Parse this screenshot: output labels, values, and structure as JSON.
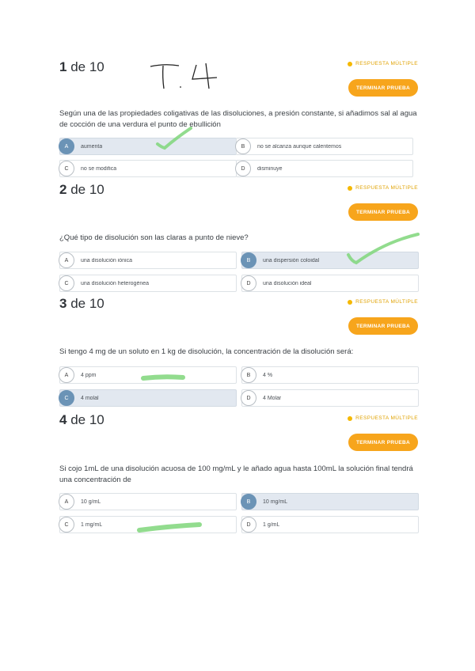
{
  "handwriting": "T 4",
  "badge_label": "RESPUESTA MÚLTIPLE",
  "end_button_label": "TERMINAR PRUEBA",
  "questions": [
    {
      "number": "1",
      "of_label": "de 10",
      "text": "Según una de las propiedades coligativas de las disoluciones, a presión constante, si añadimos sal al agua de cocción de una verdura el punto de ebullición",
      "options": [
        {
          "letter": "A",
          "text": "aumenta",
          "selected": true
        },
        {
          "letter": "B",
          "text": "no se alcanza aunque calentemos",
          "selected": false
        },
        {
          "letter": "C",
          "text": "no se modifica",
          "selected": false
        },
        {
          "letter": "D",
          "text": "disminuye",
          "selected": false
        }
      ]
    },
    {
      "number": "2",
      "of_label": "de 10",
      "text": "¿Qué tipo de disolución son las claras a punto de nieve?",
      "options": [
        {
          "letter": "A",
          "text": "una disolución iónica",
          "selected": false
        },
        {
          "letter": "B",
          "text": "una dispersión coloidal",
          "selected": true
        },
        {
          "letter": "C",
          "text": "una disolución heterogénea",
          "selected": false
        },
        {
          "letter": "D",
          "text": "una disolución ideal",
          "selected": false
        }
      ]
    },
    {
      "number": "3",
      "of_label": "de 10",
      "text": "Si tengo 4 mg de un soluto en 1 kg de disolución, la concentración de la disolución será:",
      "options": [
        {
          "letter": "A",
          "text": "4 ppm",
          "selected": false
        },
        {
          "letter": "B",
          "text": "4 %",
          "selected": false
        },
        {
          "letter": "C",
          "text": "4 molal",
          "selected": true
        },
        {
          "letter": "D",
          "text": "4 Molar",
          "selected": false
        }
      ]
    },
    {
      "number": "4",
      "of_label": "de 10",
      "text": "Si cojo 1mL de una disolución acuosa de 100 mg/mL y le añado agua hasta 100mL la solución final tendrá una concentración de",
      "options": [
        {
          "letter": "A",
          "text": "10 g/mL",
          "selected": false
        },
        {
          "letter": "B",
          "text": "10 mg/mL",
          "selected": true
        },
        {
          "letter": "C",
          "text": "1 mg/mL",
          "selected": false
        },
        {
          "letter": "D",
          "text": "1 g/mL",
          "selected": false
        }
      ]
    }
  ]
}
